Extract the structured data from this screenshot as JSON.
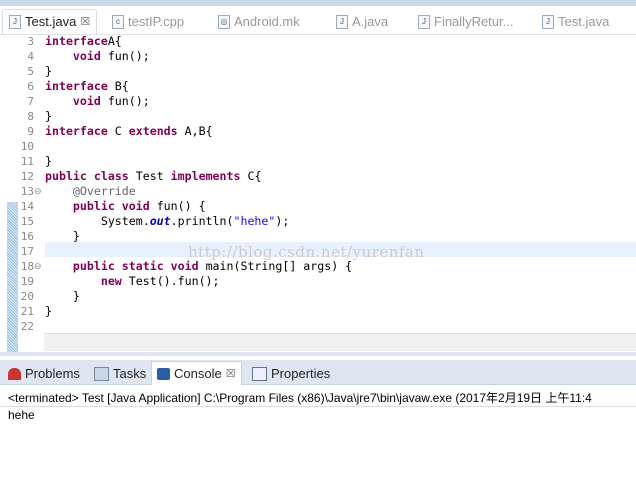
{
  "editor_tabs": [
    {
      "label": "Test.java",
      "icon": "java-file-icon",
      "active": true
    },
    {
      "label": "testIP.cpp",
      "icon": "cpp-file-icon"
    },
    {
      "label": "Android.mk",
      "icon": "mk-file-icon"
    },
    {
      "label": "A.java",
      "icon": "java-file-icon"
    },
    {
      "label": "FinallyRetur...",
      "icon": "java-file-icon"
    },
    {
      "label": "Test.java",
      "icon": "java-file-icon"
    }
  ],
  "close_glyph": "☒",
  "line_numbers": [
    "3",
    "4",
    "5",
    "6",
    "7",
    "8",
    "9",
    "10",
    "11",
    "12",
    "13",
    "14",
    "15",
    "16",
    "17",
    "18",
    "19",
    "20",
    "21",
    "22"
  ],
  "watermark": "http://blog.csdn.net/yurenfan",
  "bottom_tabs": [
    {
      "label": "Problems",
      "icon": "problems-icon"
    },
    {
      "label": "Tasks",
      "icon": "tasks-icon"
    },
    {
      "label": "Console",
      "icon": "console-icon",
      "active": true
    },
    {
      "label": "Properties",
      "icon": "properties-icon"
    }
  ],
  "console": {
    "header": "<terminated> Test [Java Application] C:\\Program Files (x86)\\Java\\jre7\\bin\\javaw.exe (2017年2月19日 上午11:4",
    "output": "hehe"
  },
  "code": [
    [
      [
        "kw",
        "interface"
      ],
      [
        "",
        "A{"
      ]
    ],
    [
      [
        "",
        "    "
      ],
      [
        "kw",
        "void"
      ],
      [
        "",
        " fun();"
      ]
    ],
    [
      [
        "",
        "}"
      ]
    ],
    [
      [
        "kw",
        "interface"
      ],
      [
        "",
        " B{"
      ]
    ],
    [
      [
        "",
        "    "
      ],
      [
        "kw",
        "void"
      ],
      [
        "",
        " fun();"
      ]
    ],
    [
      [
        "",
        "}"
      ]
    ],
    [
      [
        "kw",
        "interface"
      ],
      [
        "",
        " C "
      ],
      [
        "kw",
        "extends"
      ],
      [
        "",
        " A,B{"
      ]
    ],
    [
      [
        "",
        ""
      ]
    ],
    [
      [
        "",
        "}"
      ]
    ],
    [
      [
        "kw",
        "public"
      ],
      [
        "",
        " "
      ],
      [
        "kw",
        "class"
      ],
      [
        "",
        " Test "
      ],
      [
        "kw",
        "implements"
      ],
      [
        "",
        " C{"
      ]
    ],
    [
      [
        "",
        "    "
      ],
      [
        "ann",
        "@Override"
      ]
    ],
    [
      [
        "",
        "    "
      ],
      [
        "kw",
        "public"
      ],
      [
        "",
        " "
      ],
      [
        "kw",
        "void"
      ],
      [
        "",
        " fun() {"
      ]
    ],
    [
      [
        "",
        "        System."
      ],
      [
        "it",
        "out"
      ],
      [
        "",
        ".println("
      ],
      [
        "str",
        "\"hehe\""
      ],
      [
        "",
        ");"
      ]
    ],
    [
      [
        "",
        "    }"
      ]
    ],
    [
      [
        "",
        ""
      ]
    ],
    [
      [
        "",
        "    "
      ],
      [
        "kw",
        "public"
      ],
      [
        "",
        " "
      ],
      [
        "kw",
        "static"
      ],
      [
        "",
        " "
      ],
      [
        "kw",
        "void"
      ],
      [
        "",
        " main(String[] args) {"
      ]
    ],
    [
      [
        "",
        "        "
      ],
      [
        "kw",
        "new"
      ],
      [
        "",
        " Test().fun();"
      ]
    ],
    [
      [
        "",
        "    }"
      ]
    ],
    [
      [
        "",
        "}"
      ]
    ],
    [
      [
        "",
        ""
      ]
    ]
  ]
}
